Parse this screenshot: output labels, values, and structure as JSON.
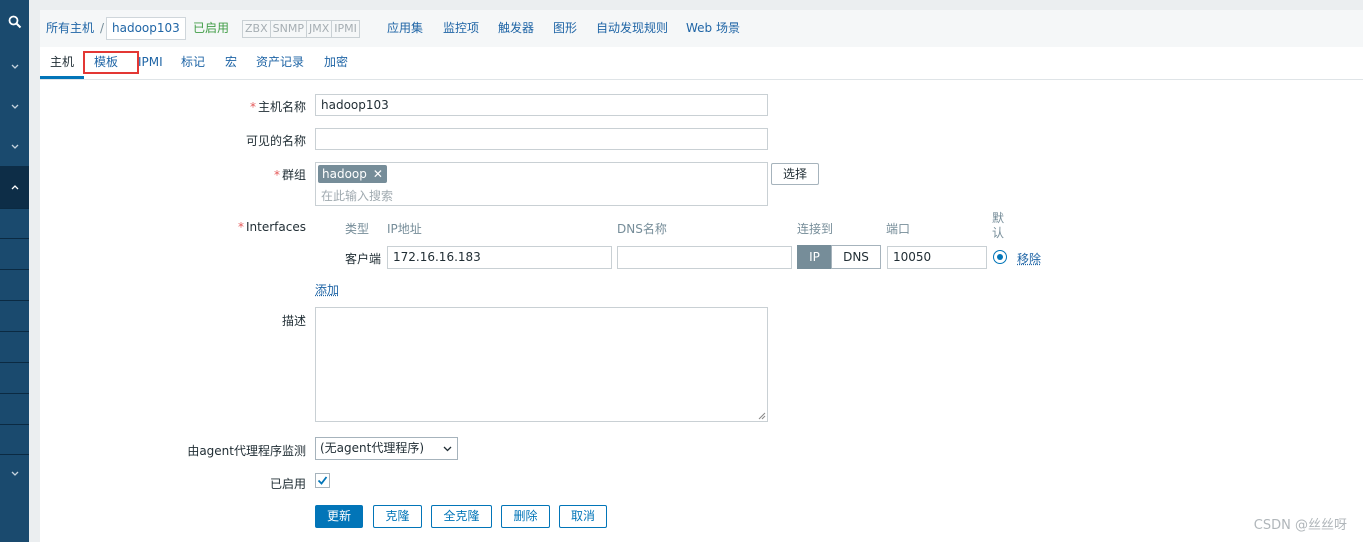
{
  "breadcrumb": {
    "all_hosts": "所有主机",
    "separator": "/",
    "host": "hadoop103",
    "status": "已启用",
    "interfaces": [
      "ZBX",
      "SNMP",
      "JMX",
      "IPMI"
    ],
    "links": [
      "应用集",
      "监控项",
      "触发器",
      "图形",
      "自动发现规则",
      "Web 场景"
    ]
  },
  "tabs": [
    "主机",
    "模板",
    "IPMI",
    "标记",
    "宏",
    "资产记录",
    "加密"
  ],
  "form": {
    "host_name_label": "主机名称",
    "host_name_value": "hadoop103",
    "visible_name_label": "可见的名称",
    "visible_name_value": "",
    "groups_label": "群组",
    "group_chip": "hadoop",
    "groups_placeholder": "在此输入搜索",
    "select_button": "选择",
    "interfaces_label": "Interfaces",
    "interface_headers": {
      "type": "类型",
      "ip": "IP地址",
      "dns": "DNS名称",
      "connect": "连接到",
      "port": "端口",
      "default": "默认"
    },
    "interface_row": {
      "type": "客户端",
      "ip": "172.16.16.183",
      "dns": "",
      "connect_ip": "IP",
      "connect_dns": "DNS",
      "port": "10050",
      "remove": "移除"
    },
    "add_link": "添加",
    "description_label": "描述",
    "proxy_label": "由agent代理程序监测",
    "proxy_value": "(无agent代理程序)",
    "enabled_label": "已启用",
    "enabled_checked": true
  },
  "buttons": {
    "update": "更新",
    "clone": "克隆",
    "full_clone": "全克隆",
    "delete": "删除",
    "cancel": "取消"
  },
  "watermark": "CSDN @丝丝呀",
  "colors": {
    "sidebar": "#1a4a6e",
    "link": "#1f65a6",
    "primary": "#0275b8",
    "enabled": "#429e47",
    "required": "#e45959",
    "highlight_box": "#e33734"
  }
}
